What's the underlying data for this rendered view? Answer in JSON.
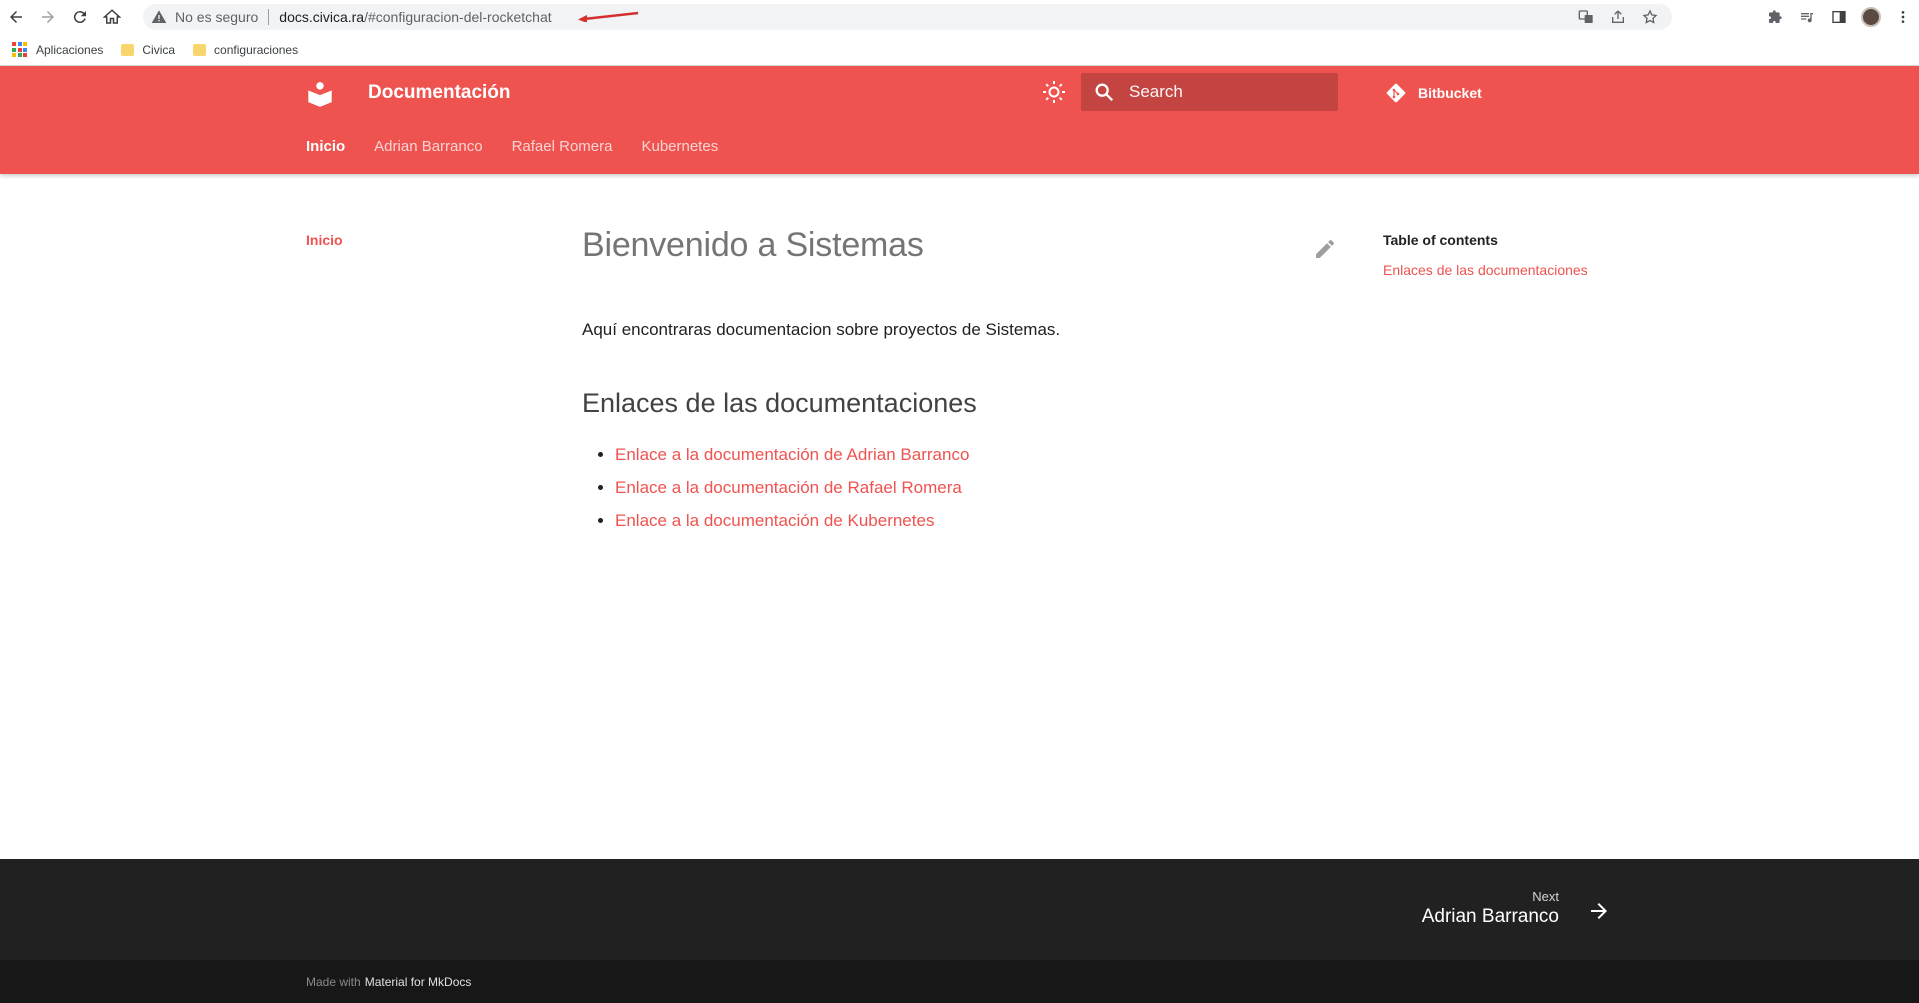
{
  "browser": {
    "security_label": "No es seguro",
    "url_host": "docs.civica.ra",
    "url_path": "/#configuracion-del-rocketchat",
    "bookmarks": [
      {
        "label": "Aplicaciones"
      },
      {
        "label": "Civica"
      },
      {
        "label": "configuraciones"
      }
    ]
  },
  "header": {
    "title": "Documentación",
    "search_placeholder": "Search",
    "repo_label": "Bitbucket",
    "accent_color": "#ef5350",
    "tabs": [
      {
        "label": "Inicio",
        "active": true
      },
      {
        "label": "Adrian Barranco"
      },
      {
        "label": "Rafael Romera"
      },
      {
        "label": "Kubernetes"
      }
    ]
  },
  "sidebar": {
    "items": [
      {
        "label": "Inicio",
        "active": true
      }
    ]
  },
  "content": {
    "title": "Bienvenido a Sistemas",
    "lead": "Aquí encontraras documentacion sobre proyectos de Sistemas.",
    "section_title": "Enlaces de las documentaciones",
    "links": [
      {
        "label": "Enlace a la documentación de Adrian Barranco"
      },
      {
        "label": "Enlace a la documentación de Rafael Romera"
      },
      {
        "label": "Enlace a la documentación de Kubernetes"
      }
    ]
  },
  "toc": {
    "title": "Table of contents",
    "items": [
      {
        "label": "Enlaces de las documentaciones"
      }
    ]
  },
  "footer": {
    "next_direction": "Next",
    "next_title": "Adrian Barranco",
    "made_with": "Made with",
    "made_with_link": "Material for MkDocs"
  }
}
